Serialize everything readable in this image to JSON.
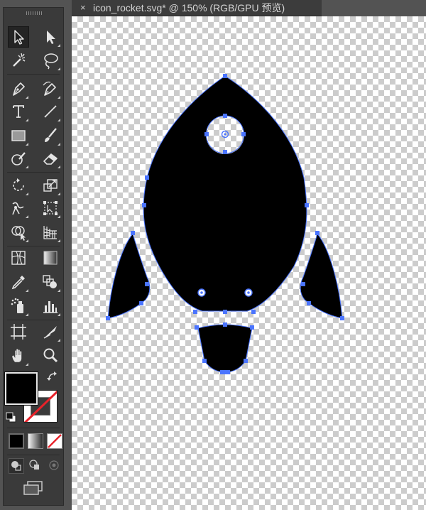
{
  "document_tab": {
    "close_glyph": "×",
    "title": "icon_rocket.svg* @ 150% (RGB/GPU 预览)"
  },
  "toolbar": {
    "tools": [
      {
        "name": "selection-tool",
        "icon": "selection-arrow"
      },
      {
        "name": "direct-selection-tool",
        "icon": "direct-selection-arrow"
      },
      {
        "name": "magic-wand-tool",
        "icon": "magic-wand"
      },
      {
        "name": "lasso-tool",
        "icon": "lasso"
      },
      {
        "name": "pen-tool",
        "icon": "pen"
      },
      {
        "name": "curvature-tool",
        "icon": "curvature-pen"
      },
      {
        "name": "type-tool",
        "icon": "type-T",
        "glyph": "T"
      },
      {
        "name": "line-segment-tool",
        "icon": "line"
      },
      {
        "name": "rectangle-tool",
        "icon": "rectangle"
      },
      {
        "name": "paintbrush-tool",
        "icon": "brush"
      },
      {
        "name": "shaper-tool",
        "icon": "shaper"
      },
      {
        "name": "eraser-tool",
        "icon": "eraser"
      },
      {
        "name": "rotate-tool",
        "icon": "rotate"
      },
      {
        "name": "scale-tool",
        "icon": "scale"
      },
      {
        "name": "warp-tool",
        "icon": "warp"
      },
      {
        "name": "free-transform-tool",
        "icon": "free-transform"
      },
      {
        "name": "shape-builder-tool",
        "icon": "shape-builder"
      },
      {
        "name": "perspective-grid-tool",
        "icon": "perspective-grid"
      },
      {
        "name": "mesh-tool",
        "icon": "mesh"
      },
      {
        "name": "gradient-tool",
        "icon": "gradient"
      },
      {
        "name": "eyedropper-tool",
        "icon": "eyedropper"
      },
      {
        "name": "blend-tool",
        "icon": "blend"
      },
      {
        "name": "symbol-sprayer-tool",
        "icon": "symbol-sprayer"
      },
      {
        "name": "column-graph-tool",
        "icon": "column-graph"
      },
      {
        "name": "artboard-tool",
        "icon": "artboard"
      },
      {
        "name": "slice-tool",
        "icon": "slice"
      },
      {
        "name": "hand-tool",
        "icon": "hand"
      },
      {
        "name": "zoom-tool",
        "icon": "zoom"
      }
    ],
    "selected_tool": "selection-tool",
    "fill_color": "#000000",
    "stroke_color": "none"
  },
  "colors": {
    "panel_bg": "#535353",
    "toolbox_bg": "#3a3a3a",
    "tab_bg": "#3c3c3c",
    "selection_blue": "#4a74ff",
    "artwork_fill": "#000000"
  },
  "artwork": {
    "name": "rocket-icon",
    "parts": [
      "rocket-body",
      "porthole",
      "left-fin",
      "right-fin",
      "exhaust-nozzle"
    ]
  }
}
